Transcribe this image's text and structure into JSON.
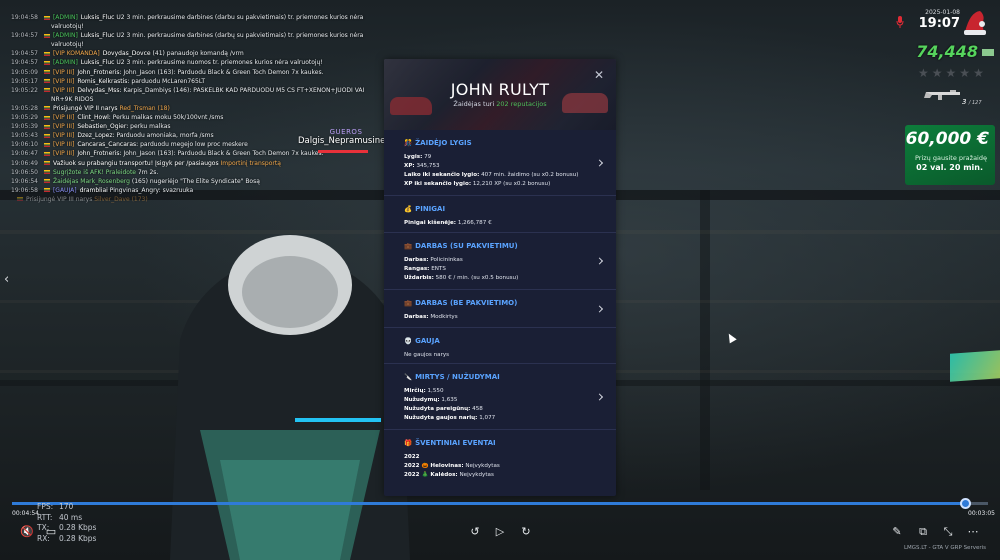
{
  "chat": [
    {
      "ts": "19:04:58",
      "tag": "[ADMIN]",
      "tag_color": "#49c35a",
      "name": "Luksis_Fluc",
      "text": "U2 3 min. perkrausime darbines (darbu su pakvietimais) tr. priemones kurios nėra"
    },
    {
      "wrap": "valruotojų!"
    },
    {
      "ts": "19:04:57",
      "tag": "[ADMIN]",
      "tag_color": "#49c35a",
      "name": "Luksis_Fluc",
      "text": "U2 3 min. perkrausime darbines (darbų su pakvietimais) tr. priemones kurios nėra"
    },
    {
      "wrap": "valruotojų!"
    },
    {
      "ts": "19:04:57",
      "tag": "[VIP KOMANDA]",
      "tag_color": "#f0a64a",
      "name": "Dovydas_Dovce",
      "text": "(41) panaudojo komandą /vrm"
    },
    {
      "ts": "19:04:57",
      "tag": "[ADMIN]",
      "tag_color": "#49c35a",
      "name": "Luksis_Fluc",
      "text": "U2 3 min. perkrausime nuomos tr. priemones kurios nėra valruotojų!"
    },
    {
      "ts": "19:05:09",
      "tag": "[VIP III]",
      "tag_color": "#f0a64a",
      "name": "John_Frotneris:",
      "text": "John_Jason (163): Parduodu Black & Green Toch Demon 7x kaukes."
    },
    {
      "ts": "19:05:17",
      "tag": "[VIP III]",
      "tag_color": "#f0a64a",
      "name": "Romis_Kelkrastis:",
      "text": "parduodu McLaren765LT"
    },
    {
      "ts": "19:05:22",
      "tag": "[VIP III]",
      "tag_color": "#f0a64a",
      "name": "Delvydas_Mss:",
      "text": "Karpis_Dambiys (146): PASKELBK KAD PARDUODU M5 CS FT+XENON+JUODI VAI"
    },
    {
      "wrap": "NR+9K RIDOS"
    },
    {
      "ts": "19:05:28",
      "tag": "",
      "tag_color": "#ffffff",
      "name": "Prisijungė VIP II narys",
      "text": "Red_Trsman (18)"
    },
    {
      "ts": "19:05:29",
      "tag": "[VIP III]",
      "tag_color": "#f0a64a",
      "name": "Clint_Howl:",
      "text": "Perku malkas moku 50k/100vnt /sms"
    },
    {
      "ts": "19:05:39",
      "tag": "[VIP III]",
      "tag_color": "#f0a64a",
      "name": "Sebastien_Ogier:",
      "text": "perku malkas"
    },
    {
      "ts": "19:05:43",
      "tag": "[VIP III]",
      "tag_color": "#f0a64a",
      "name": "Dzez_Lopez:",
      "text": "Parduodu amoniaka, morfa /sms"
    },
    {
      "ts": "19:06:10",
      "tag": "[VIP III]",
      "tag_color": "#f0a64a",
      "name": "Cancaras_Cancaras:",
      "text": "parduodu megejo low proc meskere"
    },
    {
      "ts": "19:06:47",
      "tag": "[VIP III]",
      "tag_color": "#f0a64a",
      "name": "John_Frotneris:",
      "text": "John_Jason (163): Parduodu Black & Green Toch Demon 7x kaukes."
    },
    {
      "ts": "19:06:49",
      "tag": "",
      "tag_color": "#ffffff",
      "name": "Važiuok su prabangiu transportu! Įsigyk per /pasiaugos",
      "text": "Importinį transportą"
    },
    {
      "ts": "19:06:50",
      "tag": "",
      "tag_color": "#7bd681",
      "name": "Sugrįžote iš AFK! Praleidote",
      "text": "7m 2s."
    },
    {
      "ts": "19:06:54",
      "tag": "",
      "tag_color": "#7bd681",
      "name": "Žaidėjas Mark_Rosenberg",
      "text": "(165) nugeriėjo \"The Elite Syndicate\" Bosą"
    },
    {
      "ts": "19:06:58",
      "tag": "[GAUJA]",
      "tag_color": "#8a8ff5",
      "name": "drambliai",
      "text": "Pingvinas_Angry: svazruuka"
    },
    {
      "ts": "",
      "tag": "",
      "tag_color": "#ffffff",
      "name": "Prisijungė VIP III narys",
      "text": "Silver_Dave (173)",
      "faded": true
    }
  ],
  "nametag": {
    "gang": "GUEROS",
    "nick": "Dalgis_Nepramusinek"
  },
  "hud": {
    "date": "2025-01-08",
    "time": "19:07",
    "money": "74,448",
    "stars_filled": 0,
    "stars_total": 5,
    "ammo_current": "3",
    "ammo_total": "/ 127",
    "bounty_amount": "60,000 €",
    "bounty_label": "Prizų gausite pražaidę",
    "bounty_time": "02 val. 20 min."
  },
  "profile": {
    "name": "JOHN RULYT",
    "rep_prefix": "Žaidėjas turi",
    "rep_value": "202 reputacijos",
    "close_label": "✕",
    "sections": {
      "level": {
        "title": "ŽAIDĖJO LYGIS",
        "emoji": "🎊",
        "rows": [
          {
            "k": "Lygis:",
            "v": "79"
          },
          {
            "k": "XP:",
            "v": "345,753"
          },
          {
            "k": "Laiko iki sekančio lygio:",
            "v": "407 min. žaidimo (su x0.2 bonusu)"
          },
          {
            "k": "XP iki sekančio lygio:",
            "v": "12,210 XP (su x0.2 bonusu)"
          }
        ]
      },
      "money": {
        "title": "PINIGAI",
        "emoji": "💰",
        "rows": [
          {
            "k": "Pinigai kišenėje:",
            "v": "1,266,787 €"
          }
        ]
      },
      "job_invite": {
        "title": "DARBAS (SU PAKVIETIMU)",
        "emoji": "💼",
        "rows": [
          {
            "k": "Darbas:",
            "v": "Policininkas"
          },
          {
            "k": "Rangas:",
            "v": "ENTS"
          },
          {
            "k": "Uždarbis:",
            "v": "580 € / min. (su x0.5 bonusu)"
          }
        ]
      },
      "job_free": {
        "title": "DARBAS (BE PAKVIETIMO)",
        "emoji": "💼",
        "rows": [
          {
            "k": "Darbas:",
            "v": "Modkirtys"
          }
        ]
      },
      "gang": {
        "title": "GAUJA",
        "emoji": "💀",
        "rows": [
          {
            "k": "",
            "v": "Ne gaujos narys"
          }
        ]
      },
      "kills": {
        "title": "MIRTYS / NUŽUDYMAI",
        "emoji": "🔪",
        "rows": [
          {
            "k": "Mirčių:",
            "v": "1,550"
          },
          {
            "k": "Nužudymų:",
            "v": "1,635"
          },
          {
            "k": "Nužudyta pareigūnų:",
            "v": "458"
          },
          {
            "k": "Nužudyta gaujos narių:",
            "v": "1,077"
          }
        ]
      },
      "events": {
        "title": "ŠVENTINIAI EVENTAI",
        "emoji": "🎁",
        "year": "2022",
        "rows": [
          {
            "k": "2022 🎃 Helovinas:",
            "v": "Neįvykdytas"
          },
          {
            "k": "2022 🎄 Kalėdos:",
            "v": "Neįvykdytas"
          }
        ]
      }
    }
  },
  "player": {
    "time_current": "00:04:54",
    "time_total": "00:03:05",
    "progress": 0.974,
    "stats": [
      {
        "label": "FPS:",
        "value": "170"
      },
      {
        "label": "RTT:",
        "value": "40 ms"
      },
      {
        "label": "TX:",
        "value": "0.28 Kbps"
      },
      {
        "label": "RX:",
        "value": "0.28 Kbps"
      }
    ]
  },
  "watermark": "LMGS.LT - GTA V GRP Serveris",
  "colors": {
    "accent_blue": "#5aa3ff",
    "money_green": "#56d45d",
    "rep_green": "#4dbd58",
    "progress": "#2f7bd8"
  }
}
